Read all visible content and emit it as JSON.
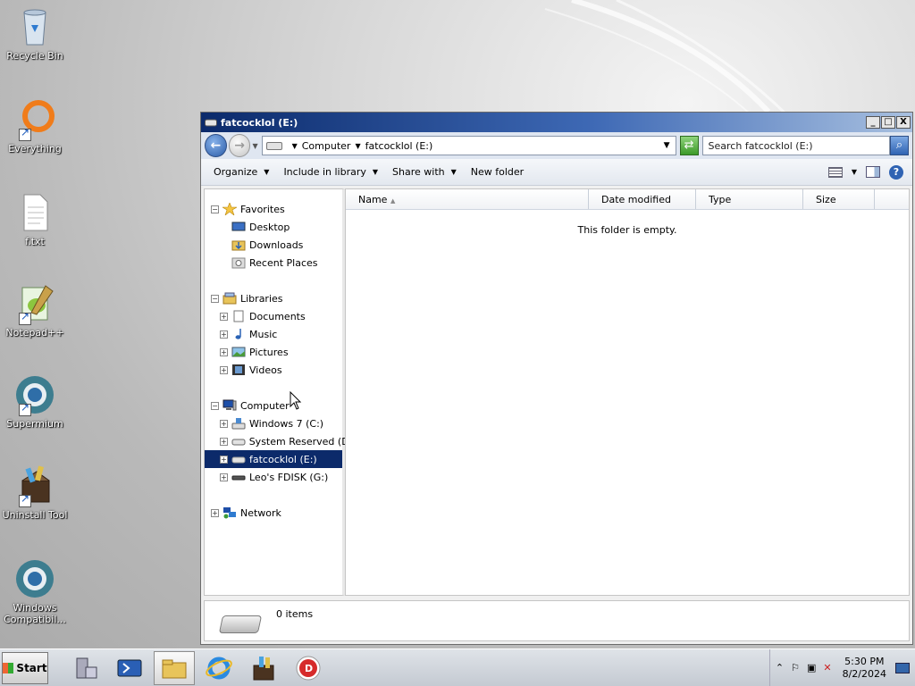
{
  "desktop": {
    "icons": [
      {
        "label": "Recycle Bin",
        "icon": "recycle-bin-icon"
      },
      {
        "label": "Everything",
        "icon": "everything-icon"
      },
      {
        "label": "f.txt",
        "icon": "text-file-icon"
      },
      {
        "label": "Notepad++",
        "icon": "notepadpp-icon"
      },
      {
        "label": "Supermium",
        "icon": "supermium-icon"
      },
      {
        "label": "Uninstall Tool",
        "icon": "uninstall-tool-icon"
      },
      {
        "label": "Windows Compatibil...",
        "icon": "windows-compat-icon"
      }
    ]
  },
  "window": {
    "title": "fatcocklol (E:)",
    "controls": {
      "minimize": "_",
      "maximize": "□",
      "close": "X"
    },
    "address": {
      "crumbs": [
        "Computer",
        "fatcocklol (E:)"
      ]
    },
    "search_placeholder": "Search fatcocklol (E:)",
    "toolbar": {
      "organize": "Organize",
      "include": "Include in library",
      "share": "Share with",
      "new_folder": "New folder"
    },
    "nav": {
      "favorites": {
        "label": "Favorites",
        "items": [
          "Desktop",
          "Downloads",
          "Recent Places"
        ]
      },
      "libraries": {
        "label": "Libraries",
        "items": [
          "Documents",
          "Music",
          "Pictures",
          "Videos"
        ]
      },
      "computer": {
        "label": "Computer",
        "items": [
          "Windows 7 (C:)",
          "System Reserved (D:)",
          "fatcocklol (E:)",
          "Leo's FDISK (G:)"
        ]
      },
      "network": {
        "label": "Network"
      }
    },
    "columns": [
      "Name",
      "Date modified",
      "Type",
      "Size"
    ],
    "empty_message": "This folder is empty.",
    "status": {
      "items": "0 items"
    }
  },
  "taskbar": {
    "start_label": "Start",
    "clock": {
      "time": "5:30 PM",
      "date": "8/2/2024"
    }
  }
}
